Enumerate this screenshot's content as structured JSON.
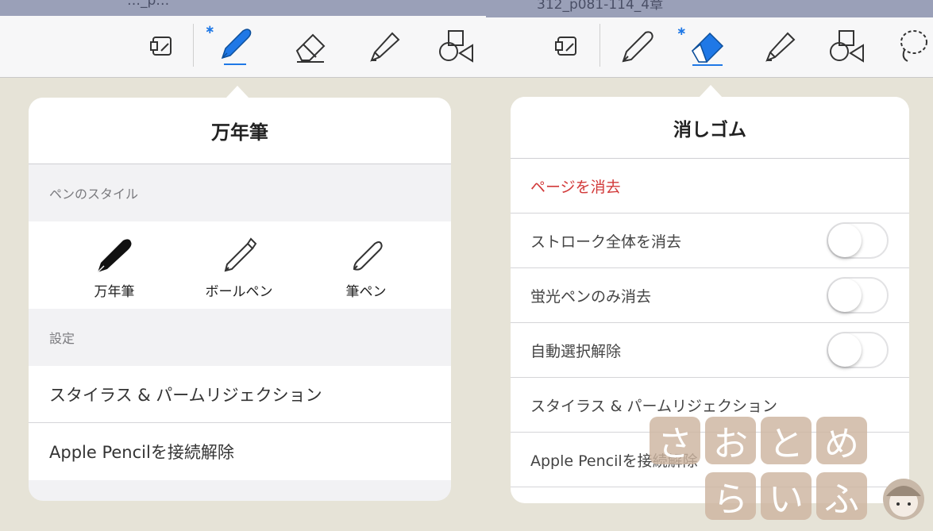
{
  "left_pane": {
    "window_title": "…_p…",
    "toolbar": {
      "tools": [
        {
          "name": "page-template-icon"
        },
        {
          "name": "fountain-pen-icon",
          "selected": true
        },
        {
          "name": "eraser-icon"
        },
        {
          "name": "highlighter-icon"
        },
        {
          "name": "shapes-icon"
        }
      ],
      "bluetooth_symbol": "∗"
    },
    "popover": {
      "title": "万年筆",
      "pen_style_header": "ペンのスタイル",
      "pen_styles": [
        {
          "label": "万年筆",
          "icon": "fountain-pen-icon",
          "selected": true
        },
        {
          "label": "ボールペン",
          "icon": "ballpoint-pen-icon",
          "selected": false
        },
        {
          "label": "筆ペン",
          "icon": "brush-pen-icon",
          "selected": false
        }
      ],
      "settings_header": "設定",
      "settings_items": [
        {
          "label": "スタイラス & パームリジェクション"
        },
        {
          "label": "Apple Pencilを接続解除"
        }
      ]
    }
  },
  "right_pane": {
    "window_title": "312_p081-114_4章",
    "toolbar": {
      "tools": [
        {
          "name": "page-template-icon"
        },
        {
          "name": "pen-icon"
        },
        {
          "name": "eraser-icon",
          "selected": true
        },
        {
          "name": "highlighter-icon"
        },
        {
          "name": "shapes-icon"
        },
        {
          "name": "lasso-icon"
        }
      ],
      "bluetooth_symbol": "∗"
    },
    "popover": {
      "title": "消しゴム",
      "rows": [
        {
          "label": "ページを消去",
          "type": "action",
          "color": "#d23a3a"
        },
        {
          "label": "ストローク全体を消去",
          "type": "toggle",
          "on": false
        },
        {
          "label": "蛍光ペンのみ消去",
          "type": "toggle",
          "on": false
        },
        {
          "label": "自動選択解除",
          "type": "toggle",
          "on": false
        },
        {
          "label": "スタイラス & パームリジェクション",
          "type": "link"
        },
        {
          "label": "Apple Pencilを接続解除",
          "type": "link"
        }
      ]
    }
  },
  "watermark": {
    "chars_row1": [
      "さ",
      "お",
      "と",
      "め"
    ],
    "chars_row2": [
      "ら",
      "い",
      "ふ"
    ]
  },
  "colors": {
    "accent": "#1f78e6",
    "danger": "#d23a3a",
    "background": "#e6e3d7"
  }
}
